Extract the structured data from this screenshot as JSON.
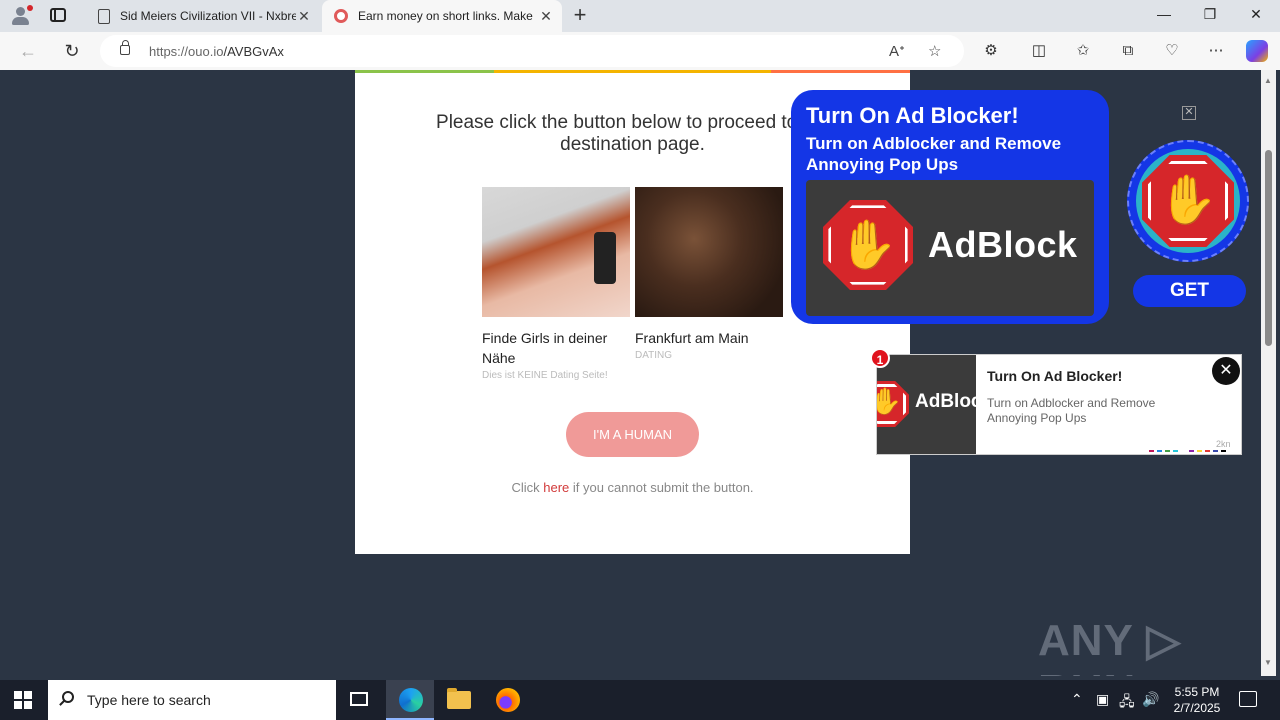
{
  "browser": {
    "tabs": [
      {
        "title": "Sid Meiers Civilization VII - Nxbre",
        "close": "✕"
      },
      {
        "title": "Earn money on short links. Make",
        "close": "✕"
      }
    ],
    "new_tab": "+",
    "window_controls": {
      "minimize": "—",
      "restore": "❐",
      "close": "✕"
    },
    "url_host": "https://ouo.io",
    "url_path": "/AVBGvAx"
  },
  "page": {
    "prompt": "Please click the button below to proceed to the destination page.",
    "ads": [
      {
        "title": "Finde Girls in deiner Nähe",
        "sub": "Dies ist KEINE Dating Seite!"
      },
      {
        "title": "Frankfurt am Main",
        "sub": "DATING"
      }
    ],
    "human_button": "I'M A HUMAN",
    "click_prefix": "Click ",
    "click_link": "here",
    "click_suffix": " if you cannot submit the button."
  },
  "popup": {
    "title": "Turn On Ad Blocker!",
    "subtitle": "Turn on Adblocker and Remove Annoying Pop Ups",
    "brand": "AdBlock",
    "get": "GET",
    "close": "✕"
  },
  "notification": {
    "badge": "1",
    "thumb_brand": "AdBlock",
    "title": "Turn On Ad Blocker!",
    "desc": "Turn on Adblocker and Remove Annoying Pop Ups",
    "source": "2kn",
    "close": "✕"
  },
  "watermark": "ANY ▷ RUN",
  "taskbar": {
    "search_placeholder": "Type here to search",
    "time": "5:55 PM",
    "date": "2/7/2025"
  },
  "colors": {
    "stripe": [
      "#8bc34a",
      "#f4b400",
      "#f4b400",
      "#ff7043"
    ],
    "accent_red": "#d6262a",
    "popup_blue": "#1436e6"
  }
}
